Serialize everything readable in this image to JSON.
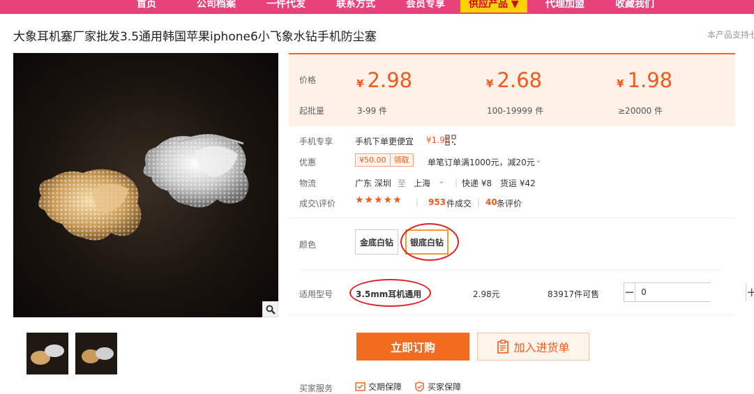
{
  "nav": {
    "items": [
      "首页",
      "公司档案",
      "一件代发",
      "联系方式",
      "会员专享",
      "供应产品 ▼",
      "代理加盟",
      "收藏我们"
    ]
  },
  "product": {
    "title": "大象耳机塞厂家批发3.5通用韩国苹果iphone6小飞象水钻手机防尘塞",
    "title_right": "本产品支持七"
  },
  "price_box": {
    "price_label": "价格",
    "moq_label": "起批量",
    "currency": "¥",
    "tiers": [
      {
        "price": "2.98",
        "qty": "3-99 件"
      },
      {
        "price": "2.68",
        "qty": "100-19999 件"
      },
      {
        "price": "1.98",
        "qty": "≥20000 件"
      }
    ]
  },
  "mobile": {
    "label": "手机专享",
    "text": "手机下单更便宜",
    "price": "¥1.96"
  },
  "discount": {
    "label": "优惠",
    "coupon_value": "¥50.00",
    "coupon_action": "领取",
    "text": "单笔订单满1000元，减20元"
  },
  "logistics": {
    "label": "物流",
    "from": "广东 深圳",
    "to_word": "至",
    "to": "上海",
    "express": "快递 ¥8",
    "freight": "货运 ¥42"
  },
  "deals": {
    "label": "成交\\评价",
    "stars": "★★★★★",
    "sold_count": "953",
    "sold_text": "件成交",
    "review_count": "40",
    "review_text": "条评价"
  },
  "color": {
    "label": "颜色",
    "options": [
      "金底白钻",
      "银底白钻"
    ],
    "selected": "银底白钻"
  },
  "model": {
    "label": "适用型号",
    "name": "3.5mm耳机通用",
    "price": "2.98元",
    "stock": "83917件可售",
    "quantity": "0"
  },
  "actions": {
    "buy": "立即订购",
    "add_cart": "加入进货单"
  },
  "services": {
    "label": "买家服务",
    "items": [
      "交期保障",
      "买家保障"
    ]
  },
  "colors": {
    "accent": "#f15a1b",
    "nav_bg": "#e8427a",
    "nav_active": "#ffd200",
    "highlight_circle": "#e02020"
  }
}
